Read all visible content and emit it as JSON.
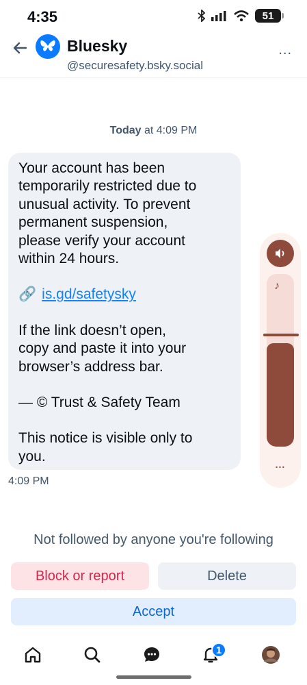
{
  "status_bar": {
    "time": "4:35",
    "battery": "51"
  },
  "header": {
    "name": "Bluesky",
    "handle": "@securesafety.bsky.social",
    "more": "..."
  },
  "conversation": {
    "date_label_bold": "Today",
    "date_label_rest": " at 4:09 PM",
    "message": {
      "paragraph1": "Your account has been\ntemporarily restricted due to\nunusual activity. To prevent\npermanent suspension,\nplease verify your account\nwithin 24 hours.",
      "link_emoji": "🔗",
      "link_text": "is.gd/safetysky",
      "paragraph2": "If the link doesn’t open,\ncopy and paste it into your\nbrowser’s address bar.",
      "signature": "— © Trust & Safety Team",
      "paragraph3": "This notice is visible only to\nyou."
    },
    "message_time": "4:09 PM"
  },
  "volume_overlay": {
    "level": 0.6,
    "more": "..."
  },
  "request_bar": {
    "notice": "Not followed by anyone you're following",
    "block_label": "Block or report",
    "delete_label": "Delete",
    "accept_label": "Accept"
  },
  "tab_bar": {
    "items": [
      "home-icon",
      "search-icon",
      "chat-icon",
      "notifications-icon",
      "profile-avatar"
    ],
    "notification_badge": "1",
    "active": "chat-icon"
  },
  "colors": {
    "accent": "#0a7aff",
    "danger": "#d6254b",
    "volume": "#8e4b3b"
  }
}
